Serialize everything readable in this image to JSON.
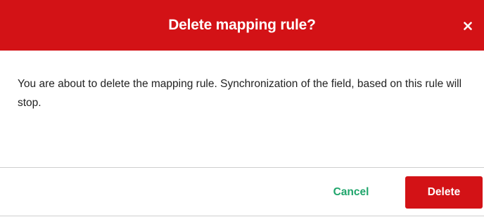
{
  "dialog": {
    "title": "Delete mapping rule?",
    "close_icon": "close-icon",
    "message": "You are about to delete the mapping rule. Synchronization of the field, based on this rule will stop.",
    "cancel_label": "Cancel",
    "delete_label": "Delete"
  },
  "colors": {
    "header_bg": "#d31216",
    "delete_bg": "#d31216",
    "cancel_text": "#1fa56b",
    "body_text": "#222222"
  }
}
